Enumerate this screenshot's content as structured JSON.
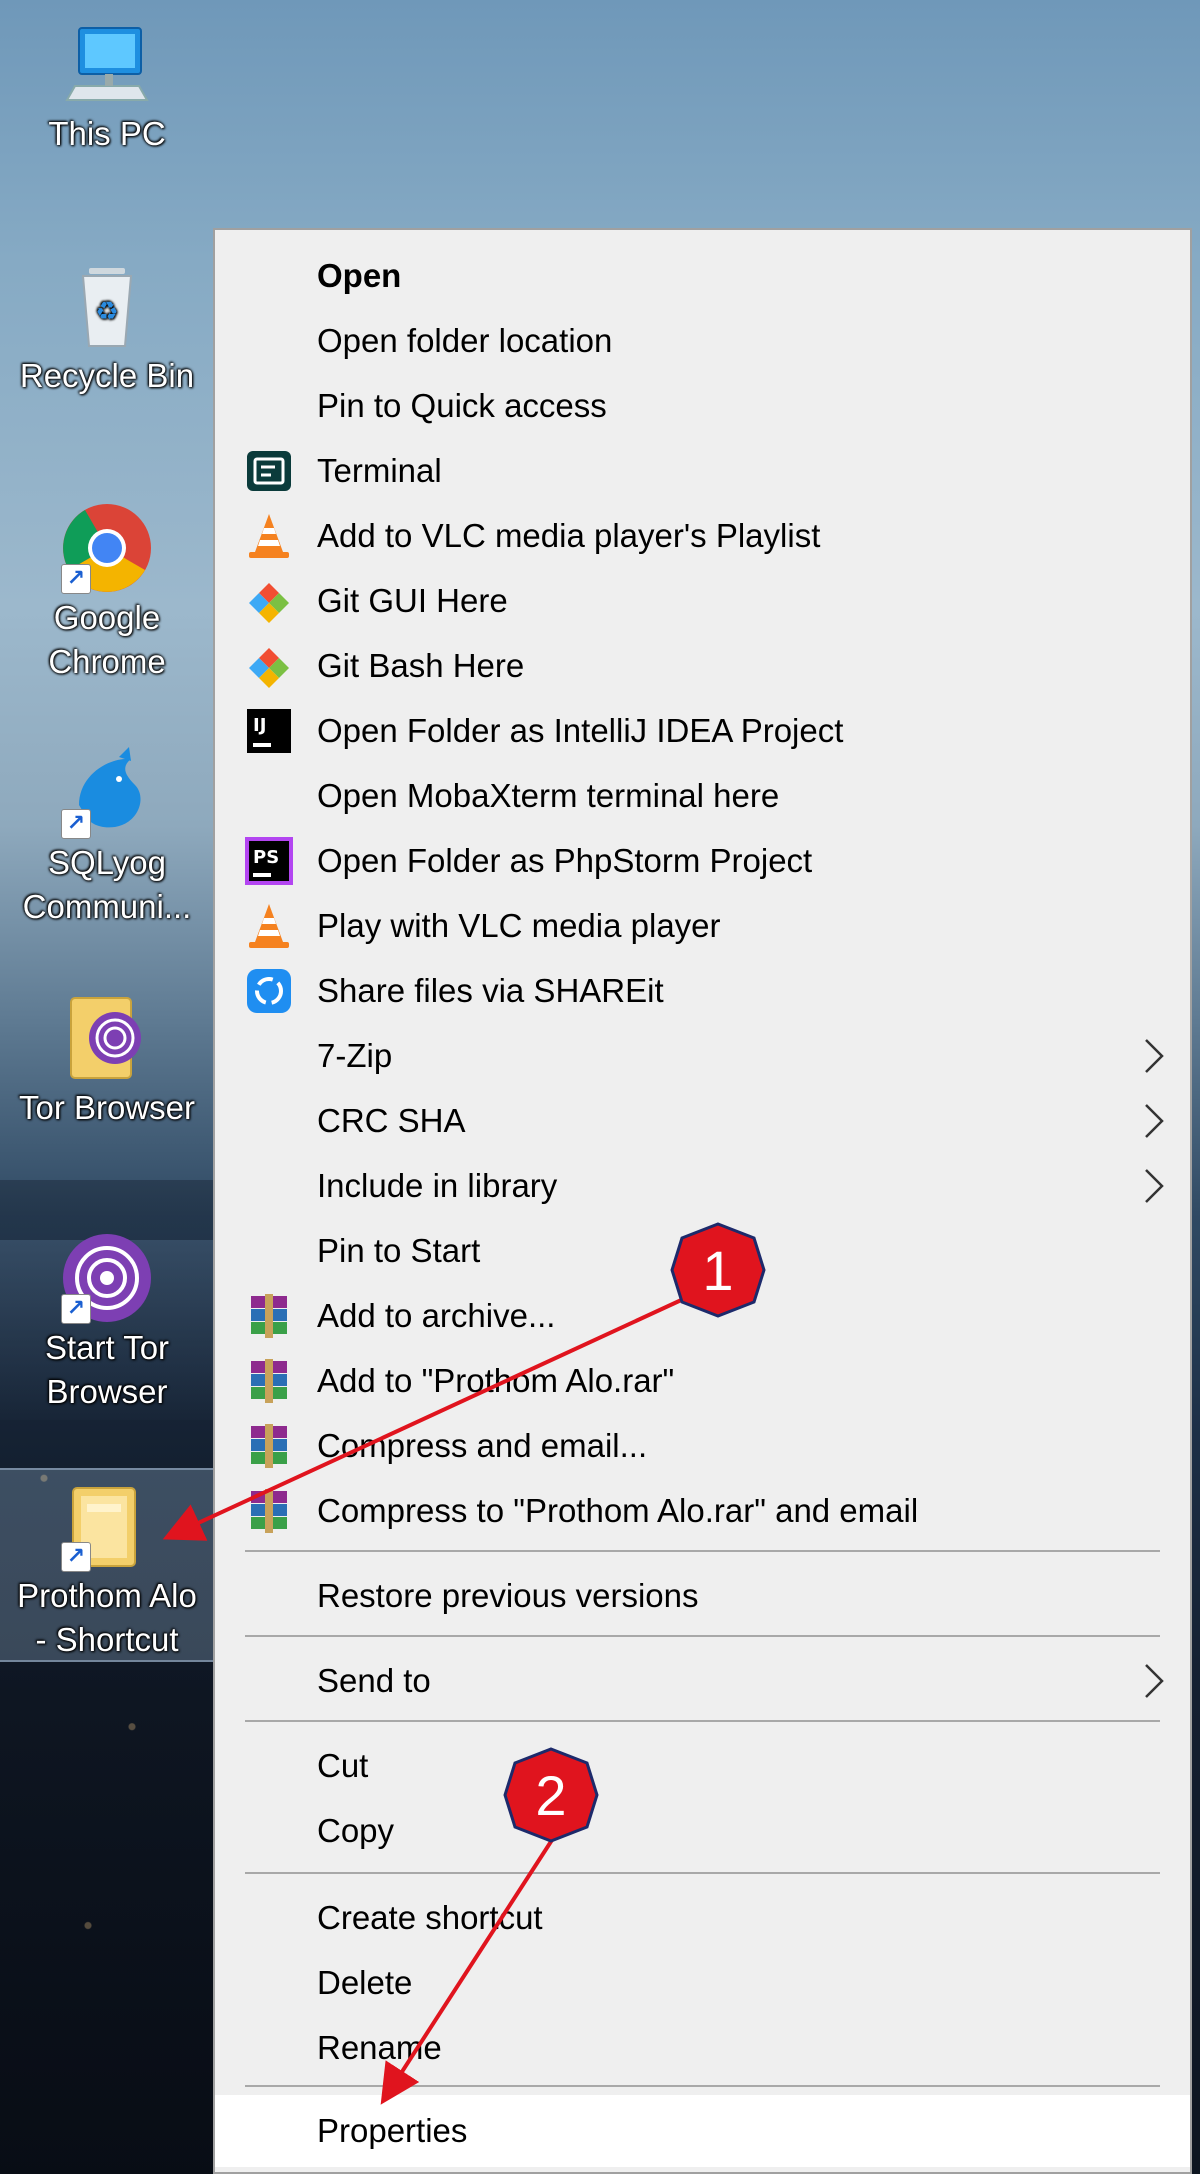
{
  "desktop": {
    "icons": [
      {
        "label": "This PC",
        "icon": "computer-icon"
      },
      {
        "label": "Recycle Bin",
        "icon": "recycle-bin-icon"
      },
      {
        "label_line1": "Google",
        "label_line2": "Chrome",
        "icon": "chrome-icon"
      },
      {
        "label_line1": "SQLyog",
        "label_line2": "Communi...",
        "icon": "sqlyog-dolphin-icon"
      },
      {
        "label": "Tor Browser",
        "icon": "tor-folder-icon"
      },
      {
        "label_line1": "Start Tor",
        "label_line2": "Browser",
        "icon": "tor-browser-icon"
      },
      {
        "label_line1": "Prothom Alo",
        "label_line2": "- Shortcut",
        "icon": "folder-shortcut-icon"
      }
    ]
  },
  "menu": {
    "items": [
      {
        "label": "Open",
        "icon": "",
        "submenu": false
      },
      {
        "label": "Open folder location",
        "icon": "",
        "submenu": false
      },
      {
        "label": "Pin to Quick access",
        "icon": "",
        "submenu": false
      },
      {
        "label": "Terminal",
        "icon": "terminal-icon",
        "submenu": false
      },
      {
        "label": "Add to VLC media player's Playlist",
        "icon": "vlc-cone-icon",
        "submenu": false
      },
      {
        "label": "Git GUI Here",
        "icon": "git-icon",
        "submenu": false
      },
      {
        "label": "Git Bash Here",
        "icon": "git-icon",
        "submenu": false
      },
      {
        "label": "Open Folder as IntelliJ IDEA Project",
        "icon": "intellij-icon",
        "submenu": false
      },
      {
        "label": "Open MobaXterm terminal here",
        "icon": "",
        "submenu": false
      },
      {
        "label": "Open Folder as PhpStorm Project",
        "icon": "phpstorm-icon",
        "submenu": false
      },
      {
        "label": "Play with VLC media player",
        "icon": "vlc-cone-icon",
        "submenu": false
      },
      {
        "label": "Share files via SHAREit",
        "icon": "shareit-icon",
        "submenu": false
      },
      {
        "label": "7-Zip",
        "icon": "",
        "submenu": true
      },
      {
        "label": "CRC SHA",
        "icon": "",
        "submenu": true
      },
      {
        "label": "Include in library",
        "icon": "",
        "submenu": true
      },
      {
        "label": "Pin to Start",
        "icon": "",
        "submenu": false
      },
      {
        "label": "Add to archive...",
        "icon": "winrar-icon",
        "submenu": false
      },
      {
        "label": "Add to \"Prothom Alo.rar\"",
        "icon": "winrar-icon",
        "submenu": false
      },
      {
        "label": "Compress and email...",
        "icon": "winrar-icon",
        "submenu": false
      },
      {
        "label": "Compress to \"Prothom Alo.rar\" and email",
        "icon": "winrar-icon",
        "submenu": false
      },
      {
        "label": "Restore previous versions",
        "icon": "",
        "submenu": false
      },
      {
        "label": "Send to",
        "icon": "",
        "submenu": true
      },
      {
        "label": "Cut",
        "icon": "",
        "submenu": false
      },
      {
        "label": "Copy",
        "icon": "",
        "submenu": false
      },
      {
        "label": "Create shortcut",
        "icon": "",
        "submenu": false
      },
      {
        "label": "Delete",
        "icon": "",
        "submenu": false
      },
      {
        "label": "Rename",
        "icon": "",
        "submenu": false
      },
      {
        "label": "Properties",
        "icon": "",
        "submenu": false
      }
    ]
  },
  "annotations": {
    "step1": "1",
    "step2": "2",
    "color": "#e0141e"
  },
  "colors": {
    "menu_bg": "#efefef",
    "highlight_bg": "#ffffff",
    "separator": "#a8a8a8"
  }
}
